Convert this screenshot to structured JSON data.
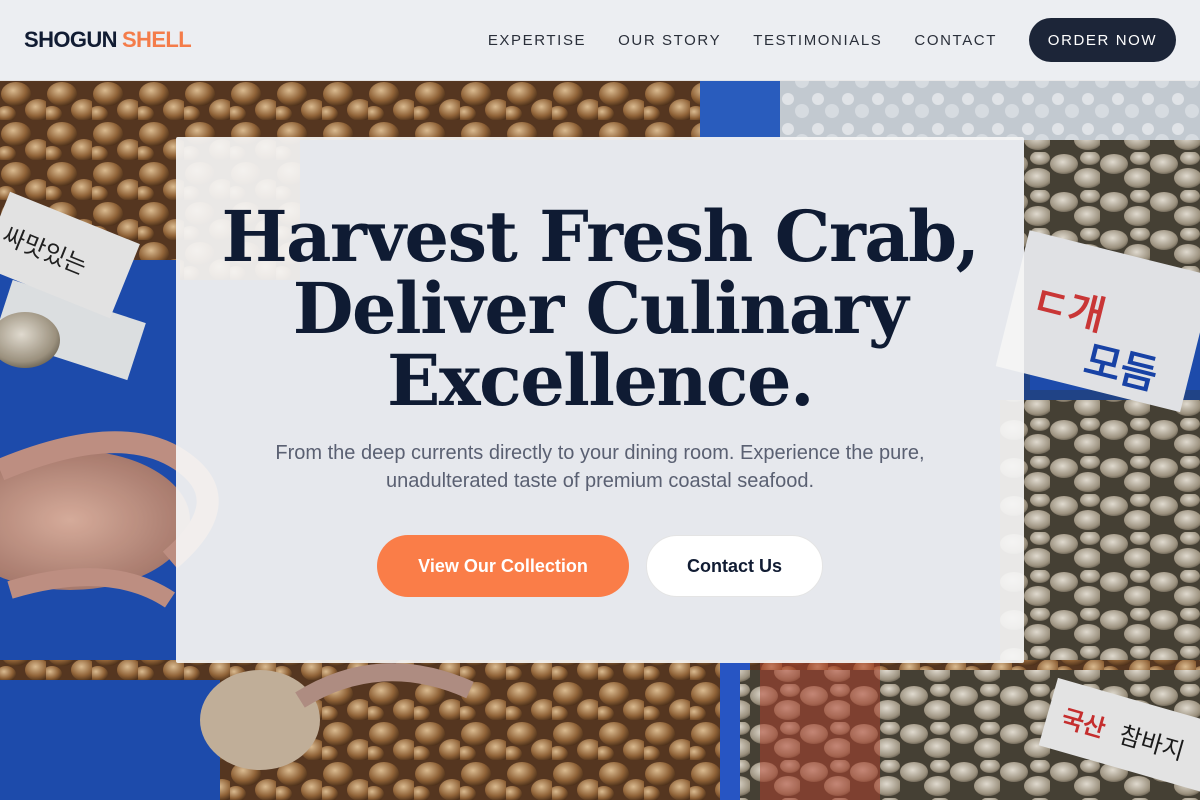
{
  "brand": {
    "name_main": "SHOGUN",
    "name_accent": "SHELL"
  },
  "nav": {
    "links": [
      {
        "label": "EXPERTISE"
      },
      {
        "label": "OUR STORY"
      },
      {
        "label": "TESTIMONIALS"
      },
      {
        "label": "CONTACT"
      }
    ],
    "cta_label": "ORDER NOW"
  },
  "hero": {
    "title_lines": [
      "Harvest Fresh Crab,",
      "Deliver Culinary",
      "Excellence."
    ],
    "subtitle": "From the deep currents directly to your dining room. Experience the pure, unadulterated taste of premium coastal seafood.",
    "primary_button": "View Our Collection",
    "secondary_button": "Contact Us",
    "background_description_icon": "seafood-market-image"
  },
  "colors": {
    "brand_dark": "#111c33",
    "brand_accent": "#f47c4a",
    "primary_button": "#fa7d48",
    "nav_cta": "#1c2538",
    "market_blue": "#1f4fb0"
  }
}
